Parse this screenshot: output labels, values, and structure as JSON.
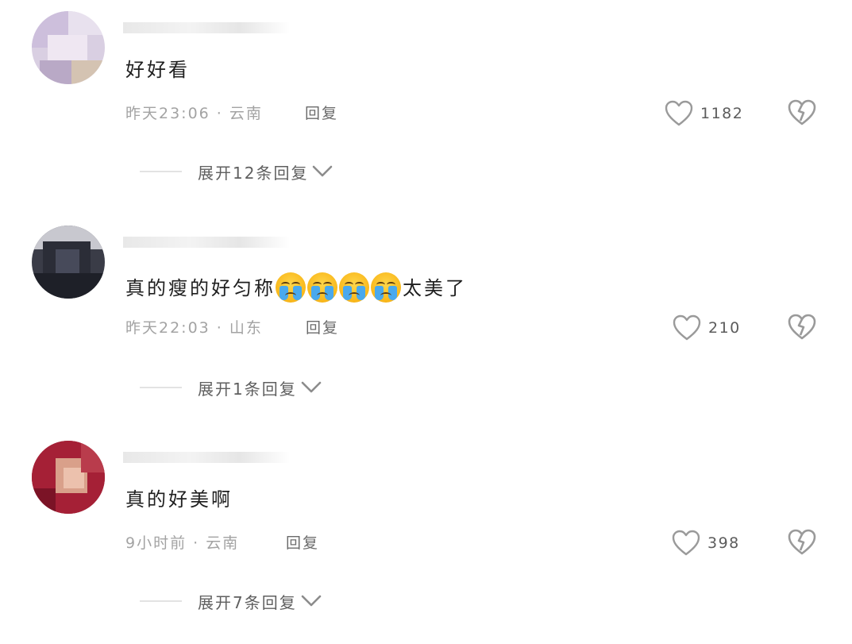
{
  "comments": [
    {
      "avatar_colors": [
        "#cdbfdc",
        "#e4dde9",
        "#d6c7b8",
        "#bfb1cb"
      ],
      "username": "",
      "text": "好好看",
      "meta": "昨天23:06 · 云南",
      "reply_label": "回复",
      "likes": "1182",
      "expand_label": "展开12条回复"
    },
    {
      "avatar_colors": [
        "#3b3e4a",
        "#21232b",
        "#c9c9cf",
        "#545664"
      ],
      "username": "",
      "text_before": "真的瘦的好匀称",
      "emoji_name": "loudly-crying-face-icon",
      "emoji_count": 4,
      "text_after": "太美了",
      "meta": "昨天22:03 · 山东",
      "reply_label": "回复",
      "likes": "210",
      "expand_label": "展开1条回复"
    },
    {
      "avatar_colors": [
        "#a31f34",
        "#d89a86",
        "#7c1225",
        "#e7b8a2"
      ],
      "username": "",
      "text": "真的好美啊",
      "meta": "9小时前 · 云南",
      "reply_label": "回复",
      "likes": "398",
      "expand_label": "展开7条回复"
    }
  ],
  "icons": {
    "like": "heart-outline-icon",
    "dislike": "broken-heart-icon",
    "expand": "chevron-down-icon"
  },
  "colors": {
    "text_primary": "#1f1f1f",
    "text_secondary": "#a3a3a3",
    "icon_gray": "#9a9a9a"
  }
}
